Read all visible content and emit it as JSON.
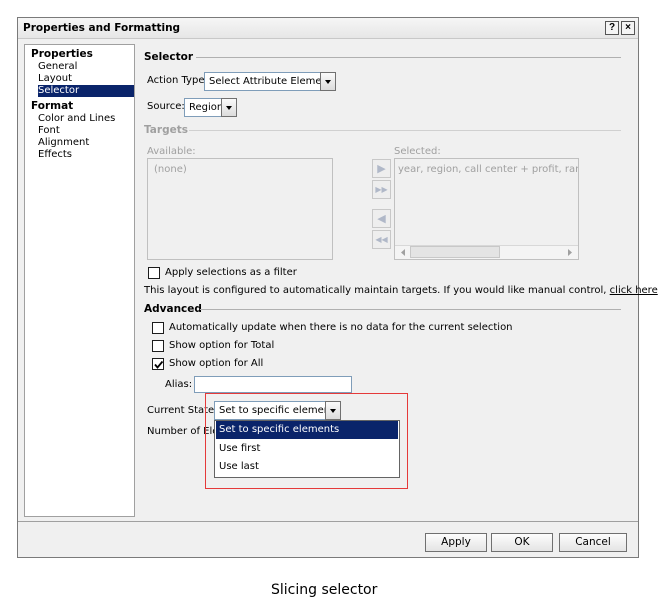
{
  "dialog": {
    "title": "Properties and Formatting",
    "help_label": "?",
    "close_label": "×"
  },
  "nav": {
    "properties_header": "Properties",
    "properties_items": [
      "General",
      "Layout",
      "Selector"
    ],
    "format_header": "Format",
    "format_items": [
      "Color and Lines",
      "Font",
      "Alignment",
      "Effects"
    ],
    "selected_item": "Selector"
  },
  "selector": {
    "header": "Selector",
    "action_type_label": "Action Type:",
    "action_type_value": "Select Attribute Element",
    "source_label": "Source:",
    "source_value": "Region"
  },
  "targets": {
    "header": "Targets",
    "available_label": "Available:",
    "available_value": "(none)",
    "selected_label": "Selected:",
    "selected_value": "year, region, call center + profit, rank(pr",
    "move_right": "▶",
    "move_all_right": "▶▶",
    "move_left": "◀",
    "move_all_left": "◀◀",
    "apply_filter_label": "Apply selections as a filter",
    "apply_filter_checked": false,
    "info_text": "This layout is configured to automatically maintain targets. If you would like manual control,",
    "info_link": "click here",
    "info_end": "."
  },
  "advanced": {
    "header": "Advanced",
    "auto_update_label": "Automatically update when there is no data for the current selection",
    "auto_update_checked": false,
    "show_total_label": "Show option for Total",
    "show_total_checked": false,
    "show_all_label": "Show option for All",
    "show_all_checked": true,
    "alias_label": "Alias:",
    "alias_value": "",
    "current_state_label": "Current State:",
    "current_state_value": "Set to specific elements",
    "number_label": "Number of Elem",
    "state_options": [
      "Set to specific elements",
      "Use first",
      "Use last"
    ]
  },
  "buttons": {
    "apply": "Apply",
    "ok": "OK",
    "cancel": "Cancel"
  },
  "caption": "Slicing selector",
  "colors": {
    "selection": "#0a246a",
    "highlight": "#e53a3a"
  }
}
